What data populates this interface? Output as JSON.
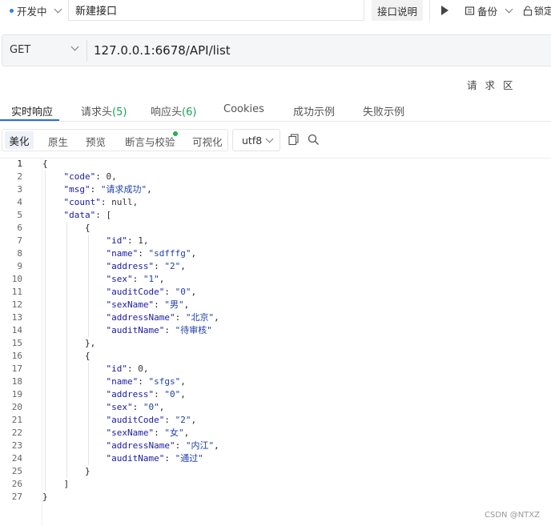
{
  "topbar": {
    "status": "开发中",
    "api_name": "新建接口",
    "doc_button": "接口说明",
    "backup": "备份",
    "lock": "锁定"
  },
  "request": {
    "method": "GET",
    "url": "127.0.0.1:6678/API/list",
    "area_label": "请 求 区"
  },
  "tabs": [
    {
      "label": "实时响应",
      "count": ""
    },
    {
      "label": "请求头",
      "count": "(5)"
    },
    {
      "label": "响应头",
      "count": "(6)"
    },
    {
      "label": "Cookies",
      "count": ""
    },
    {
      "label": "成功示例",
      "count": ""
    },
    {
      "label": "失败示例",
      "count": ""
    }
  ],
  "view_buttons": [
    "美化",
    "原生",
    "预览",
    "断言与校验",
    "可视化"
  ],
  "encoding": "utf8",
  "code_lines": [
    "{",
    "    \"code\": 0,",
    "    \"msg\": \"请求成功\",",
    "    \"count\": null,",
    "    \"data\": [",
    "        {",
    "            \"id\": 1,",
    "            \"name\": \"sdfffg\",",
    "            \"address\": \"2\",",
    "            \"sex\": \"1\",",
    "            \"auditCode\": \"0\",",
    "            \"sexName\": \"男\",",
    "            \"addressName\": \"北京\",",
    "            \"auditName\": \"待审核\"",
    "        },",
    "        {",
    "            \"id\": 0,",
    "            \"name\": \"sfgs\",",
    "            \"address\": \"0\",",
    "            \"sex\": \"0\",",
    "            \"auditCode\": \"2\",",
    "            \"sexName\": \"女\",",
    "            \"addressName\": \"内江\",",
    "            \"auditName\": \"通过\"",
    "        }",
    "    ]",
    "}"
  ],
  "watermark": "CSDN @NTXZ",
  "colors": {
    "accent": "#2b6fd6",
    "count_green": "#18a058",
    "status_dot": "#2f7bf6"
  }
}
